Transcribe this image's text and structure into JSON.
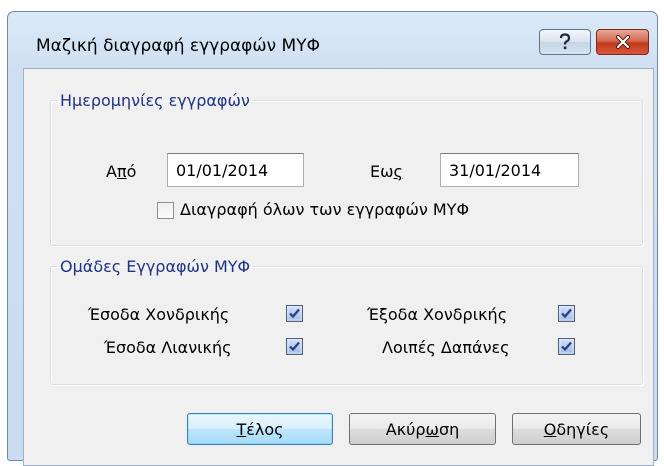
{
  "window": {
    "title": "Μαζική διαγραφή εγγραφών ΜΥΦ"
  },
  "dates_group": {
    "legend": "Ημερομηνίες εγγραφών",
    "from_label_pre": "Α",
    "from_label_ul": "π",
    "from_label_post": "ό",
    "from_value": "01/01/2014",
    "to_label_pre": "Εω",
    "to_label_ul": "ς",
    "to_value": "31/01/2014",
    "delete_all_label": "Διαγραφή όλων των εγγραφών ΜΥΦ",
    "delete_all_checked": false
  },
  "groups_group": {
    "legend": "Ομάδες Εγγραφών ΜΥΦ",
    "items": [
      {
        "label": "Έσοδα Χονδρικής",
        "checked": true
      },
      {
        "label": "Έξοδα Χονδρικής",
        "checked": true
      },
      {
        "label": "Έσοδα Λιανικής",
        "checked": true
      },
      {
        "label": "Λοιπές Δαπάνες",
        "checked": true
      }
    ]
  },
  "buttons": {
    "finish_ul": "Τ",
    "finish_rest": "έλος",
    "cancel_pre": "Ακύρ",
    "cancel_ul": "ω",
    "cancel_post": "ση",
    "help_ul": "Ο",
    "help_rest": "δηγίες"
  },
  "colors": {
    "legend_text": "#1e3287",
    "close_button": "#c2381c",
    "title_bar": "#cfe0f2"
  }
}
